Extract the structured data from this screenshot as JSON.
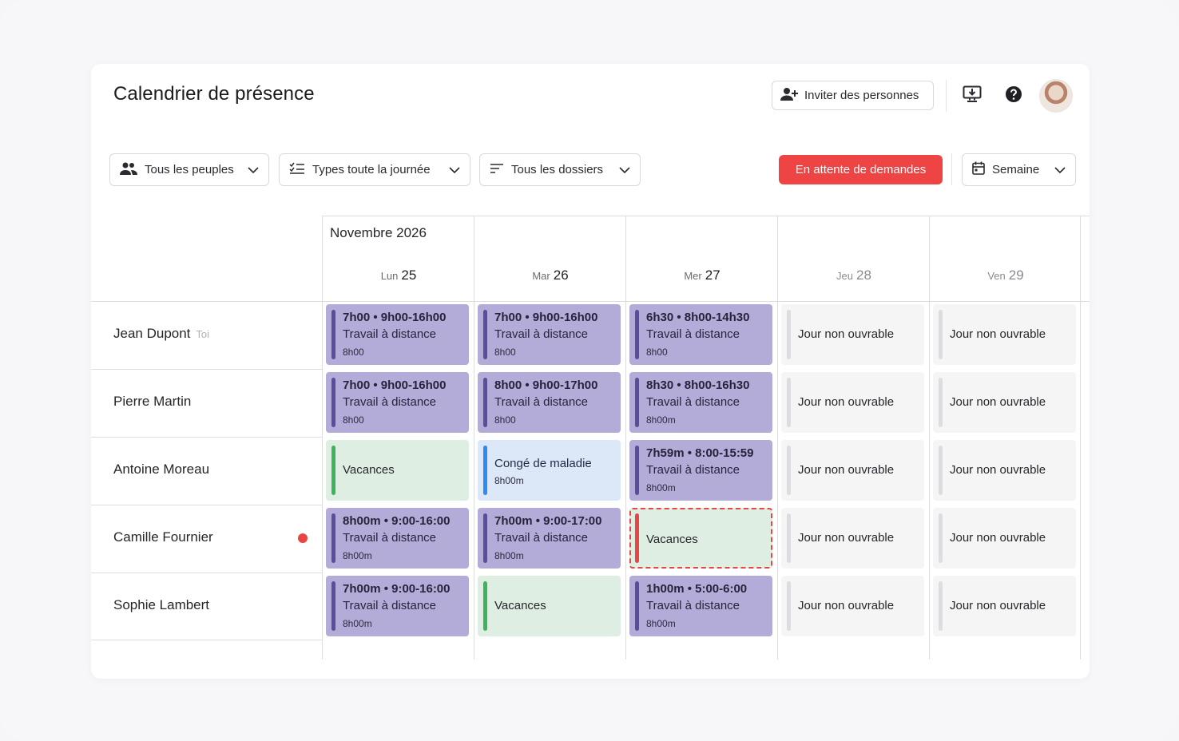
{
  "page": {
    "title": "Calendrier de présence"
  },
  "header": {
    "invite_label": "Inviter des personnes",
    "icons": [
      "add-user-icon",
      "monitor-download-icon",
      "help-icon",
      "avatar"
    ]
  },
  "filters": {
    "people": "Tous les peuples",
    "types": "Types toute la journée",
    "folders": "Tous les dossiers",
    "pending": "En attente de demandes",
    "view": "Semaine"
  },
  "calendar": {
    "month": "Novembre 2026",
    "days": [
      {
        "dow": "Lun",
        "num": "25"
      },
      {
        "dow": "Mar",
        "num": "26"
      },
      {
        "dow": "Mer",
        "num": "27"
      },
      {
        "dow": "Jeu",
        "num": "28"
      },
      {
        "dow": "Ven",
        "num": "29"
      }
    ],
    "people": [
      {
        "name": "Jean Dupont",
        "tag": "Toi",
        "alert": false,
        "cells": [
          {
            "kind": "work",
            "l1": "7h00 • 9h00-16h00",
            "l2": "Travail à distance",
            "l3": "8h00"
          },
          {
            "kind": "work",
            "l1": "7h00 • 9h00-16h00",
            "l2": "Travail à distance",
            "l3": "8h00"
          },
          {
            "kind": "work",
            "l1": "6h30 • 8h00-14h30",
            "l2": "Travail à distance",
            "l3": "8h00"
          },
          {
            "kind": "off",
            "label": "Jour non ouvrable"
          },
          {
            "kind": "off",
            "label": "Jour non ouvrable"
          }
        ]
      },
      {
        "name": "Pierre Martin",
        "tag": "",
        "alert": false,
        "cells": [
          {
            "kind": "work",
            "l1": "7h00 • 9h00-16h00",
            "l2": "Travail à distance",
            "l3": "8h00"
          },
          {
            "kind": "work",
            "l1": "8h00 • 9h00-17h00",
            "l2": "Travail à distance",
            "l3": "8h00"
          },
          {
            "kind": "work",
            "l1": "8h30 • 8h00-16h30",
            "l2": "Travail à distance",
            "l3": "8h00m"
          },
          {
            "kind": "off",
            "label": "Jour non ouvrable"
          },
          {
            "kind": "off",
            "label": "Jour non ouvrable"
          }
        ]
      },
      {
        "name": "Antoine Moreau",
        "tag": "",
        "alert": false,
        "cells": [
          {
            "kind": "vac",
            "label": "Vacances"
          },
          {
            "kind": "sick",
            "l2": "Congé de maladie",
            "l3": "8h00m"
          },
          {
            "kind": "work",
            "l1": "7h59m • 8:00-15:59",
            "l2": "Travail à distance",
            "l3": "8h00m"
          },
          {
            "kind": "off",
            "label": "Jour non ouvrable"
          },
          {
            "kind": "off",
            "label": "Jour non ouvrable"
          }
        ]
      },
      {
        "name": "Camille Fournier",
        "tag": "",
        "alert": true,
        "cells": [
          {
            "kind": "work",
            "l1": "8h00m • 9:00-16:00",
            "l2": "Travail à distance",
            "l3": "8h00m"
          },
          {
            "kind": "work",
            "l1": "7h00m • 9:00-17:00",
            "l2": "Travail à distance",
            "l3": "8h00m"
          },
          {
            "kind": "pending",
            "label": "Vacances"
          },
          {
            "kind": "off",
            "label": "Jour non ouvrable"
          },
          {
            "kind": "off",
            "label": "Jour non ouvrable"
          }
        ]
      },
      {
        "name": "Sophie Lambert",
        "tag": "",
        "alert": false,
        "cells": [
          {
            "kind": "work",
            "l1": "7h00m • 9:00-16:00",
            "l2": "Travail à distance",
            "l3": "8h00m"
          },
          {
            "kind": "vac",
            "label": "Vacances"
          },
          {
            "kind": "work",
            "l1": "1h00m • 5:00-6:00",
            "l2": "Travail à distance",
            "l3": "8h00m"
          },
          {
            "kind": "off",
            "label": "Jour non ouvrable"
          },
          {
            "kind": "off",
            "label": "Jour non ouvrable"
          }
        ]
      }
    ]
  },
  "colors": {
    "accent_red": "#ee4444",
    "work_bg": "#b3acd9",
    "work_bar": "#5a4d9b",
    "vacation_bg": "#dfeee2",
    "vacation_bar": "#3fb35b",
    "sick_bg": "#dce8f7",
    "sick_bar": "#2a8cf0",
    "off_bg": "#f5f5f6"
  }
}
